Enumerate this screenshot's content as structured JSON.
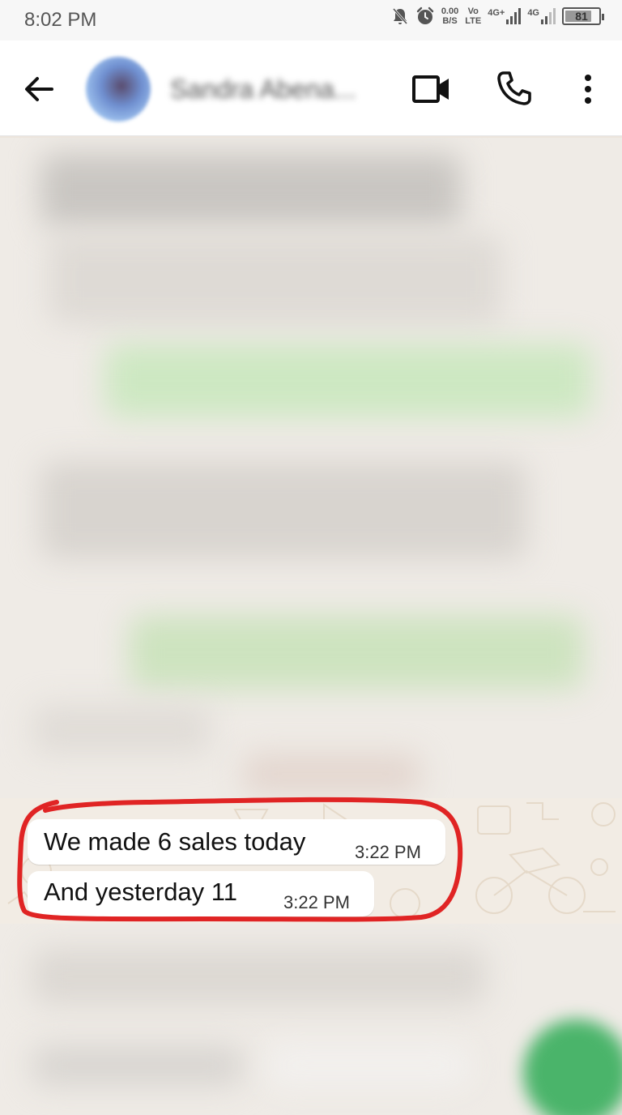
{
  "status_bar": {
    "time": "8:02 PM",
    "net_speed": "0.00",
    "net_unit": "B/S",
    "volte_top": "Vo",
    "volte_bottom": "LTE",
    "net_type_1": "4G+",
    "net_type_2": "4G",
    "battery": "81",
    "battery_level": 0.81
  },
  "header": {
    "contact_name": "Sandra Abena...",
    "icons": [
      "back-arrow-icon",
      "video-call-icon",
      "phone-icon",
      "more-vert-icon"
    ]
  },
  "messages": [
    {
      "text": "We made 6 sales today",
      "time": "3:22 PM"
    },
    {
      "text": "And yesterday 11",
      "time": "3:22 PM"
    }
  ],
  "colors": {
    "header_bg": "#ffffff",
    "chat_bg": "#efebe6",
    "bubble_bg": "#ffffff",
    "annotation": "#e02424",
    "fab": "#4ab46a"
  }
}
